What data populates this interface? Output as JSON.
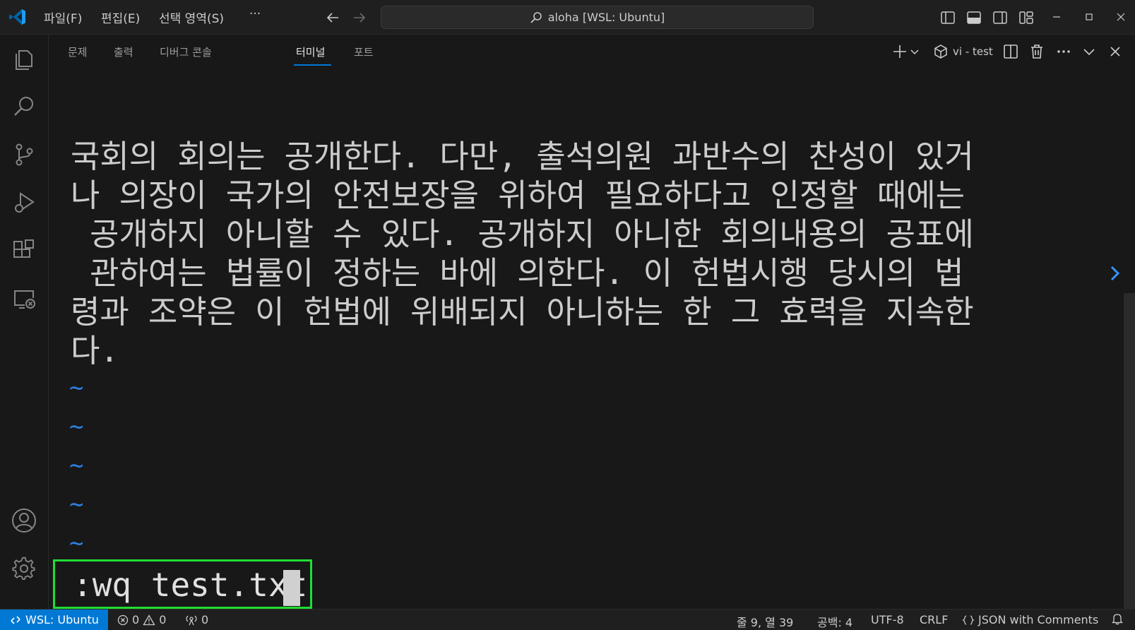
{
  "titlebar": {
    "menu": [
      "파일(F)",
      "편집(E)",
      "선택 영역(S)",
      "···"
    ],
    "command_center": "aloha [WSL: Ubuntu]"
  },
  "panel": {
    "tabs": [
      "문제",
      "출력",
      "디버그 콘솔",
      "터미널",
      "포트"
    ],
    "active_tab": "터미널",
    "terminal_name": "vi - test"
  },
  "terminal": {
    "lines": [
      "국회의 회의는 공개한다. 다만, 출석의원 과반수의 찬성이 있거",
      "나 의장이 국가의 안전보장을 위하여 필요하다고 인정할 때에는",
      " 공개하지 아니할 수 있다. 공개하지 아니한 회의내용의 공표에",
      " 관하여는 법률이 정하는 바에 의한다. 이 헌법시행 당시의 법",
      "령과 조약은 이 헌법에 위배되지 아니하는 한 그 효력을 지속한",
      "다."
    ],
    "tilde": "~",
    "command": ":wq test.txt"
  },
  "statusbar": {
    "remote": "WSL: Ubuntu",
    "errors": "0",
    "warnings": "0",
    "ports": "0",
    "position": "줄 9, 열 39",
    "spaces": "공백: 4",
    "encoding": "UTF-8",
    "eol": "CRLF",
    "language": "JSON with Comments"
  },
  "colors": {
    "accent": "#0078d4",
    "highlight_box": "#1fdd34",
    "tilde": "#2f7fdd",
    "background": "#181818"
  },
  "icons": [
    "vscode-logo",
    "back-arrow",
    "forward-arrow",
    "search-icon",
    "explorer-icon",
    "source-control-icon",
    "run-debug-icon",
    "extensions-icon",
    "remote-explorer-icon",
    "account-icon",
    "settings-gear-icon",
    "bell-icon"
  ]
}
